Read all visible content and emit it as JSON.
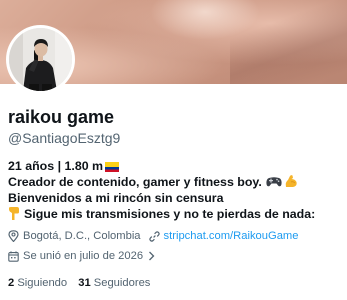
{
  "profile": {
    "display_name": "raikou game",
    "handle": "@SantiagoEsztg9"
  },
  "bio": {
    "line1": "21 años | 1.80 m",
    "line1_flag": "colombia-flag",
    "line2": "Creador de contenido, gamer y fitness boy.",
    "line2_emojis": [
      "game-controller-icon",
      "flexed-biceps-icon"
    ],
    "line3": "Bienvenidos a mi rincón sin censura",
    "line4_emoji": "pointing-down-icon",
    "line4": "Sigue mis transmisiones y no te pierdas de nada:"
  },
  "meta": {
    "location_icon": "location-pin-icon",
    "location": "Bogotá, D.C., Colombia",
    "link_icon": "link-icon",
    "link": "stripchat.com/RaikouGame",
    "joined_icon": "calendar-icon",
    "joined": "Se unió en julio de 2026"
  },
  "stats": {
    "following_count": "2",
    "following_label": "Siguiendo",
    "followers_count": "31",
    "followers_label": "Seguidores"
  },
  "colors": {
    "accent": "#1d9bf0",
    "secondary_text": "#536471",
    "primary_text": "#0f1419"
  }
}
